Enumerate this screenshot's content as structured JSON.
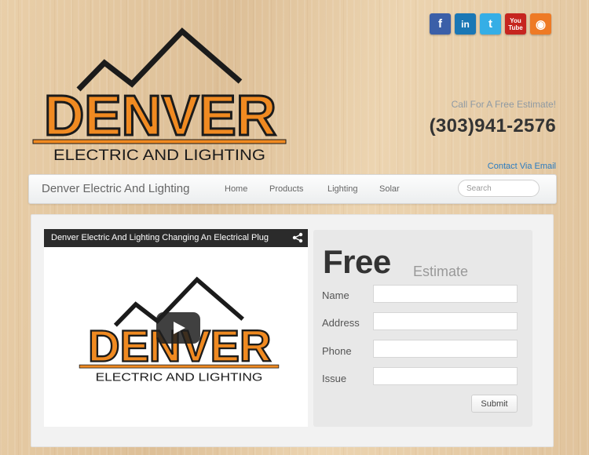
{
  "social": [
    {
      "name": "facebook-icon",
      "glyph": "f",
      "color": "#3b5fa8"
    },
    {
      "name": "linkedin-icon",
      "glyph": "in",
      "color": "#1a77b5"
    },
    {
      "name": "twitter-icon",
      "glyph": "t",
      "color": "#35aee6"
    },
    {
      "name": "youtube-icon",
      "glyph_top": "You",
      "glyph_bottom": "Tube",
      "color": "#c6251f"
    },
    {
      "name": "rss-icon",
      "glyph": "◉",
      "color": "#ee7a25"
    }
  ],
  "logo": {
    "word": "DENVER",
    "tagline": "ELECTRIC AND LIGHTING",
    "accent": "#f08a21",
    "outline": "#1b1b1b"
  },
  "header": {
    "cta": "Call For A Free Estimate!",
    "phone": "(303)941-2576",
    "contact_link": "Contact Via Email"
  },
  "nav": {
    "brand": "Denver Electric And Lighting",
    "items": [
      "Home",
      "Products",
      "Lighting",
      "Solar"
    ],
    "search_placeholder": "Search"
  },
  "video": {
    "title": "Denver Electric And Lighting Changing An Electrical Plug"
  },
  "form": {
    "title": "Free",
    "subtitle": "Estimate",
    "fields": [
      "Name",
      "Address",
      "Phone",
      "Issue"
    ],
    "submit": "Submit"
  }
}
